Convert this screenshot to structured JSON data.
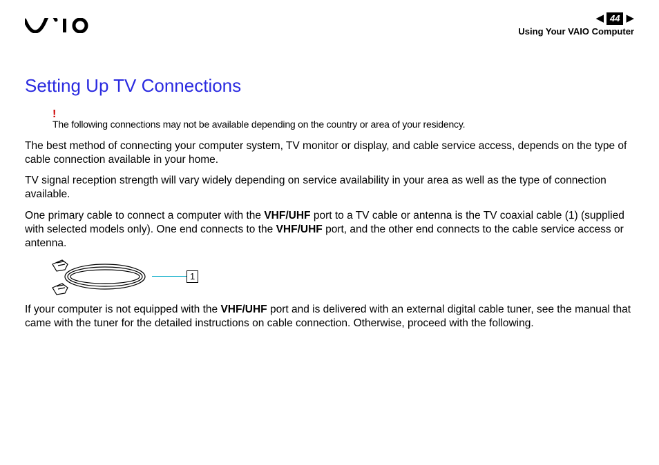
{
  "header": {
    "page_number": "44",
    "section": "Using Your VAIO Computer",
    "nav_prev": "◀",
    "nav_next": "▶"
  },
  "content": {
    "heading": "Setting Up TV Connections",
    "alert_mark": "!",
    "alert_text": "The following connections may not be available depending on the country or area of your residency.",
    "para1": "The best method of connecting your computer system, TV monitor or display, and cable service access, depends on the type of cable connection available in your home.",
    "para2": "TV signal reception strength will vary widely depending on service availability in your area as well as the type of connection available.",
    "para3_a": "One primary cable to connect a computer with the ",
    "para3_b": "VHF/UHF",
    "para3_c": " port to a TV cable or antenna is the TV coaxial cable (1) (supplied with selected models only). One end connects to the ",
    "para3_d": "VHF/UHF",
    "para3_e": " port, and the other end connects to the cable service access or antenna.",
    "figure_callout": "1",
    "para4_a": "If your computer is not equipped with the ",
    "para4_b": "VHF/UHF",
    "para4_c": " port and is delivered with an external digital cable tuner, see the manual that came with the tuner for the detailed instructions on cable connection. Otherwise, proceed with the following."
  }
}
